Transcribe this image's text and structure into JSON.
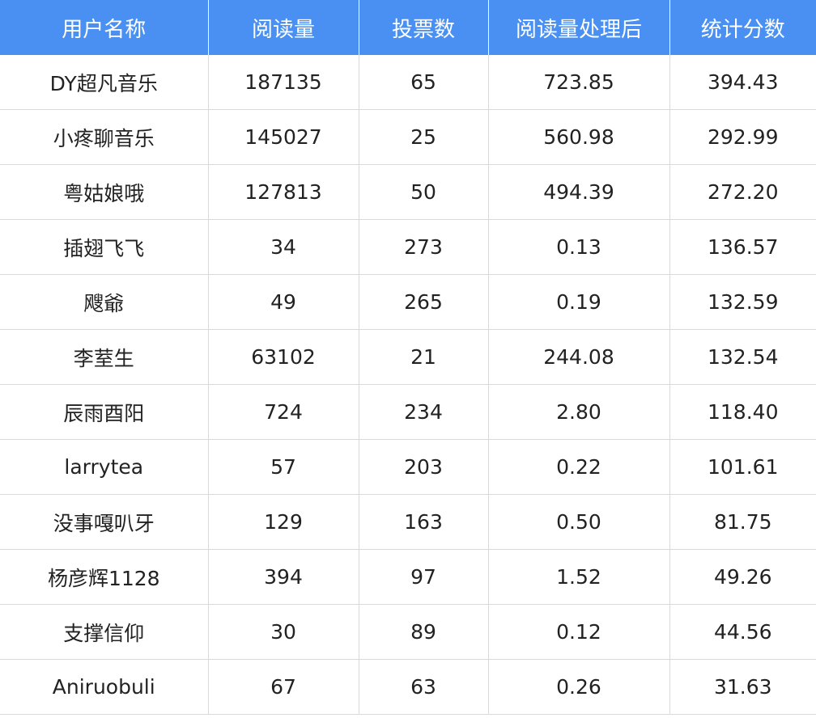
{
  "table": {
    "headers": [
      "用户名称",
      "阅读量",
      "投票数",
      "阅读量处理后",
      "统计分数"
    ],
    "rows": [
      [
        "DY超凡音乐",
        "187135",
        "65",
        "723.85",
        "394.43"
      ],
      [
        "小疼聊音乐",
        "145027",
        "25",
        "560.98",
        "292.99"
      ],
      [
        "粤姑娘哦",
        "127813",
        "50",
        "494.39",
        "272.20"
      ],
      [
        "插翅飞飞",
        "34",
        "273",
        "0.13",
        "136.57"
      ],
      [
        "飕爺",
        "49",
        "265",
        "0.19",
        "132.59"
      ],
      [
        "李荎生",
        "63102",
        "21",
        "244.08",
        "132.54"
      ],
      [
        "辰雨酉阳",
        "724",
        "234",
        "2.80",
        "118.40"
      ],
      [
        "larrytea",
        "57",
        "203",
        "0.22",
        "101.61"
      ],
      [
        "没事嘎叭牙",
        "129",
        "163",
        "0.50",
        "81.75"
      ],
      [
        "杨彦辉1128",
        "394",
        "97",
        "1.52",
        "49.26"
      ],
      [
        "支撑信仰",
        "30",
        "89",
        "0.12",
        "44.56"
      ],
      [
        "Aniruobuli",
        "67",
        "63",
        "0.26",
        "31.63"
      ]
    ]
  },
  "colors": {
    "header_bg": "#4a90f2",
    "header_text": "#ffffff",
    "grid_line": "#d9d9d9",
    "cell_text": "#222222"
  }
}
